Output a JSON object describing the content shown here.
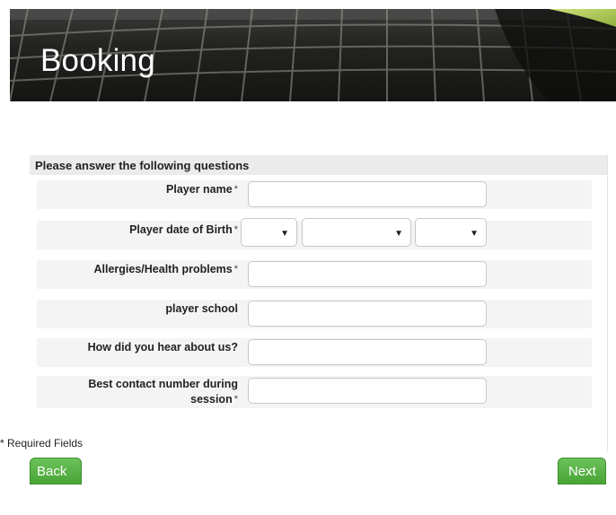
{
  "banner": {
    "title": "Booking"
  },
  "form": {
    "header": "Please answer the following questions",
    "required_mark": "*",
    "fields": {
      "player_name": {
        "label": "Player name",
        "value": ""
      },
      "dob": {
        "label": "Player date of Birth",
        "day": "",
        "month": "",
        "year": ""
      },
      "allergies": {
        "label": "Allergies/Health problems",
        "value": ""
      },
      "school": {
        "label": "player school",
        "value": ""
      },
      "hear": {
        "label": "How did you hear about us?",
        "value": ""
      },
      "contact": {
        "label_line1": "Best contact number during",
        "label_line2": "session",
        "value": ""
      }
    },
    "required_note": "* Required Fields"
  },
  "buttons": {
    "back": "Back",
    "next": "Next"
  },
  "icons": {
    "dropdown": "chevron-down-icon"
  },
  "colors": {
    "accent": "#4fa93c",
    "header_bg": "#ebebeb"
  }
}
